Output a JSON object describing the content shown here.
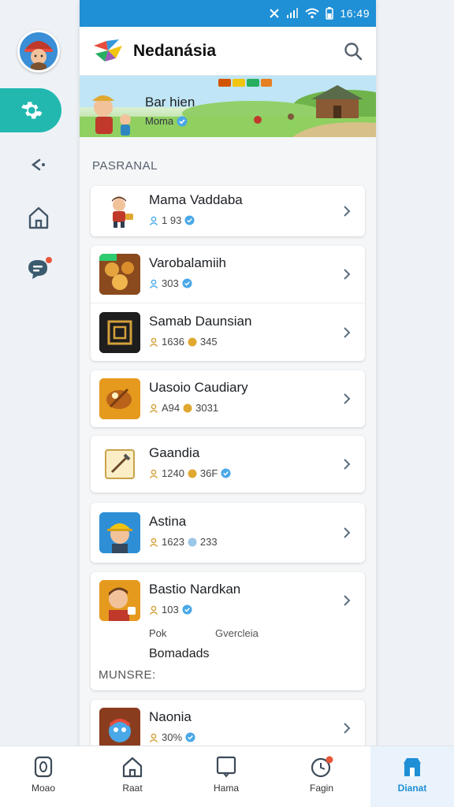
{
  "status": {
    "time": "16:49"
  },
  "app": {
    "title": "Nedanásia"
  },
  "banner": {
    "title": "Bar hien",
    "subtitle": "Moma"
  },
  "section": {
    "label": "PASRANAL"
  },
  "items": [
    {
      "title": "Mama Vaddaba",
      "meta1": "1 93",
      "meta2": ""
    },
    {
      "title": "Varobalamiih",
      "meta1": "303",
      "meta2": ""
    },
    {
      "title": "Samab Daunsian",
      "meta1": "1636",
      "meta2": "345"
    },
    {
      "title": "Uasoio Caudiary",
      "meta1": "A94",
      "meta2": "3031"
    },
    {
      "title": "Gaandia",
      "meta1": "1240",
      "meta2": "36F"
    },
    {
      "title": "Astina",
      "meta1": "1623",
      "meta2": "233"
    },
    {
      "title": "Bastio Nardkan",
      "meta1": "103",
      "meta2": "",
      "extra_a": "Pok",
      "extra_b": "Gvercleia",
      "extra_c": "Bomadads",
      "extra_d": "MUNSRE:"
    },
    {
      "title": "Naonia",
      "meta1": "30%",
      "meta2": ""
    }
  ],
  "nav": [
    {
      "label": "Moao",
      "icon": "badge-icon"
    },
    {
      "label": "Raat",
      "icon": "home-icon"
    },
    {
      "label": "Hama",
      "icon": "tablet-icon"
    },
    {
      "label": "Fagin",
      "icon": "clock-icon"
    },
    {
      "label": "Dianat",
      "icon": "store-icon"
    }
  ],
  "colors": {
    "accent": "#1f8fd6",
    "rail_active": "#22b8b0",
    "badge": "#e8563a"
  }
}
